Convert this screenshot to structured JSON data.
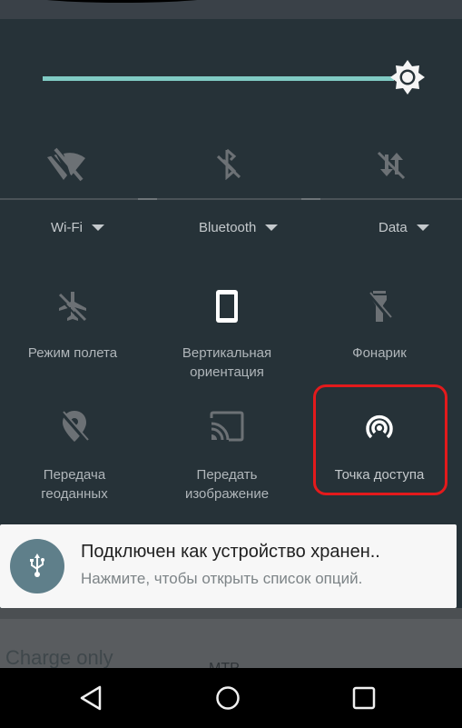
{
  "brightness": {
    "level_percent": 98,
    "accent_color": "#80cbc4",
    "icon": "brightness-auto-icon"
  },
  "connectivity_tiles": [
    {
      "id": "wifi",
      "label": "Wi-Fi",
      "icon": "wifi-off-icon",
      "state": "off"
    },
    {
      "id": "bluetooth",
      "label": "Bluetooth",
      "icon": "bluetooth-off-icon",
      "state": "off"
    },
    {
      "id": "data",
      "label": "Data",
      "icon": "data-off-icon",
      "state": "off"
    }
  ],
  "tiles": [
    {
      "id": "airplane",
      "label": "Режим полета",
      "icon": "airplane-off-icon",
      "state": "off"
    },
    {
      "id": "rotation",
      "label_line1": "Вертикальная",
      "label_line2": "ориентация",
      "icon": "portrait-phone-icon",
      "state": "on"
    },
    {
      "id": "flashlight",
      "label": "Фонарик",
      "icon": "flashlight-off-icon",
      "state": "off"
    },
    {
      "id": "location",
      "label_line1": "Передача",
      "label_line2": "геоданных",
      "icon": "location-off-icon",
      "state": "off"
    },
    {
      "id": "cast",
      "label_line1": "Передать",
      "label_line2": "изображение",
      "icon": "cast-icon",
      "state": "off"
    },
    {
      "id": "hotspot",
      "label": "Точка доступа",
      "icon": "hotspot-icon",
      "state": "on",
      "highlighted": true
    }
  ],
  "highlight_color": "#e31a1c",
  "notification": {
    "icon": "usb-icon",
    "title": "Подключен как устройство хранен..",
    "subtitle": "Нажмите, чтобы открыть список опций."
  },
  "background_content": {
    "text": "Charge only",
    "text2": "MTP"
  },
  "navbar": {
    "back": "back-icon",
    "home": "home-icon",
    "recents": "recents-icon"
  }
}
